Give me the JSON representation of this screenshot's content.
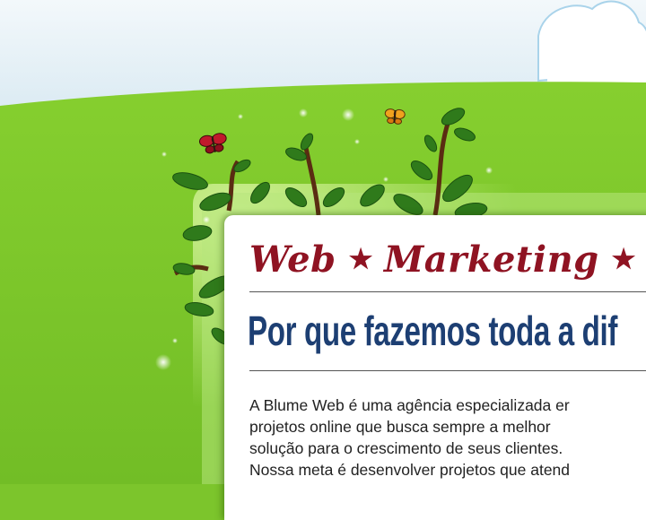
{
  "colors": {
    "grass": "#7cc52c",
    "sky": "#dcecf4",
    "tagline": "#8f1322",
    "headline": "#1d3f73",
    "body_text": "#222222"
  },
  "icons": [
    "butterfly-icon",
    "butterfly-icon",
    "sparkle-icon",
    "plant-illustration",
    "star-icon"
  ],
  "content": {
    "tagline": {
      "word1": "Web",
      "word2": "Marketing",
      "star": "★"
    },
    "headline": "Por que fazemos toda a dif",
    "paragraph": [
      "A Blume Web é uma agência especializada er",
      "projetos online que busca sempre a melhor",
      "solução para o crescimento de seus clientes.",
      "Nossa meta é desenvolver projetos que atend"
    ]
  }
}
